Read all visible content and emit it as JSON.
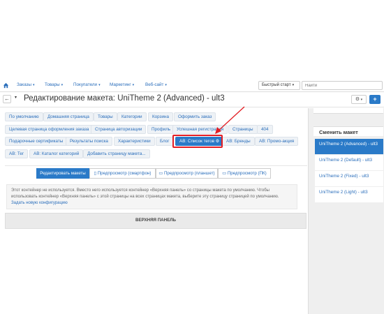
{
  "nav": {
    "items": [
      "Заказы",
      "Товары",
      "Покупатели",
      "Маркетинг",
      "Веб-сайт"
    ],
    "quick_start": "Быстрый старт",
    "search_placeholder": "Найти"
  },
  "header": {
    "title": "Редактирование макета: UniTheme 2 (Advanced) - ult3",
    "back_label": "←",
    "add_label": "+"
  },
  "pages": [
    "По умолчанию",
    "Домашняя страница",
    "Товары",
    "Категории",
    "Корзина",
    "Оформить заказ",
    "Целевая страница оформления заказа",
    "Страница авторизации",
    "Профиль",
    "Успешная регистрация",
    "Страницы",
    "404",
    "Подарочные сертификаты",
    "Результаты поиска",
    "Характеристики",
    "Блог",
    "AB: Список тегов",
    "AB: Бренды",
    "AB: Промо-акция",
    "AB: Тег",
    "AB: Каталог категорий",
    "Добавить страницу макета..."
  ],
  "active_page": "AB: Список тегов",
  "view_tabs": [
    "Редактировать макеты",
    "Предпросмотр (смартфон)",
    "Предпросмотр (планшет)",
    "Предпросмотр (ПК)"
  ],
  "notice": {
    "text": "Этот контейнер не используется. Вместо него используется контейнер «Верхняя панель» со страницы макета по умолчанию. Чтобы использовать контейнер «Верхняя панель» с этой страницы на всех страницах макета, выберите эту страницу страницей по умолчанию.",
    "link": "Задать новую конфигурацию"
  },
  "panel_title": "ВЕРХНЯЯ ПАНЕЛЬ",
  "sidebar": {
    "title": "Сменить макет",
    "layouts": [
      "UniTheme 2 (Advanced) - ult3",
      "UniTheme 2 (Default) - ult3",
      "UniTheme 2 (Fixed) - ult3",
      "UniTheme 2 (Light) - ult3"
    ]
  },
  "colors": {
    "accent": "#2a7ac8",
    "highlight": "#e31e24"
  }
}
